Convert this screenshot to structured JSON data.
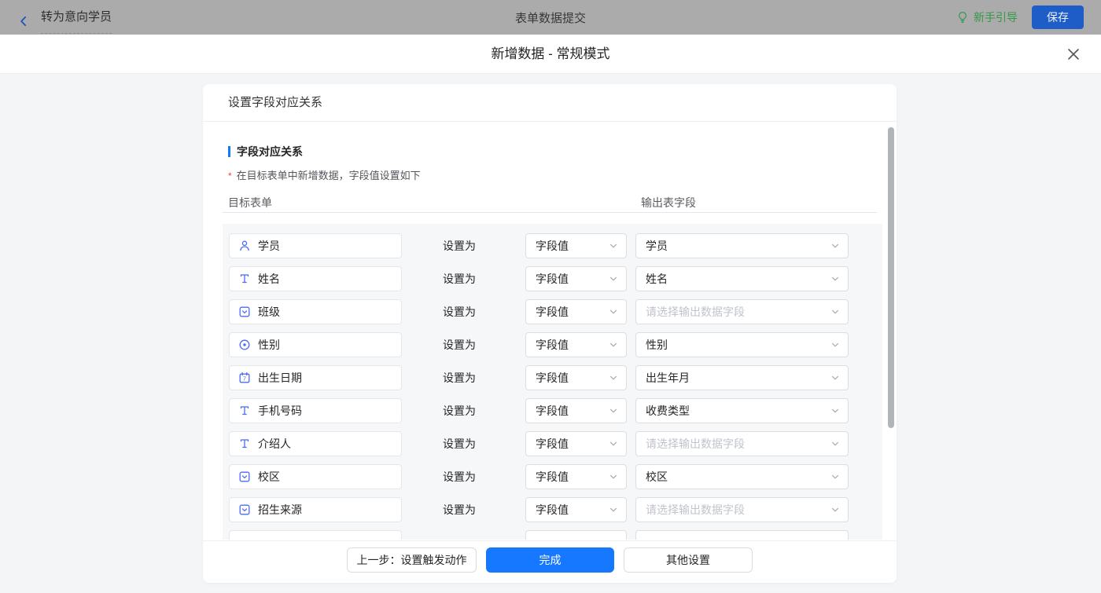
{
  "topbar": {
    "back_label": "转为意向学员",
    "title": "表单数据提交",
    "guide_label": "新手引导",
    "save_label": "保存"
  },
  "modal": {
    "title": "新增数据 - 常规模式"
  },
  "panel": {
    "header": "设置字段对应关系",
    "section_title": "字段对应关系",
    "note_mark": "*",
    "note": "在目标表单中新增数据，字段值设置如下",
    "col_left": "目标表单",
    "col_right": "输出表字段",
    "set_as_label": "设置为",
    "rows": [
      {
        "icon": "user-icon",
        "field": "学员",
        "mode": "字段值",
        "output": "学员",
        "placeholder": false
      },
      {
        "icon": "text-icon",
        "field": "姓名",
        "mode": "字段值",
        "output": "姓名",
        "placeholder": false
      },
      {
        "icon": "select-icon",
        "field": "班级",
        "mode": "字段值",
        "output": "请选择输出数据字段",
        "placeholder": true
      },
      {
        "icon": "radio-icon",
        "field": "性别",
        "mode": "字段值",
        "output": "性别",
        "placeholder": false
      },
      {
        "icon": "date-icon",
        "field": "出生日期",
        "mode": "字段值",
        "output": "出生年月",
        "placeholder": false
      },
      {
        "icon": "text-icon",
        "field": "手机号码",
        "mode": "字段值",
        "output": "收费类型",
        "placeholder": false
      },
      {
        "icon": "text-icon",
        "field": "介绍人",
        "mode": "字段值",
        "output": "请选择输出数据字段",
        "placeholder": true
      },
      {
        "icon": "select-icon",
        "field": "校区",
        "mode": "字段值",
        "output": "校区",
        "placeholder": false
      },
      {
        "icon": "select-icon",
        "field": "招生来源",
        "mode": "字段值",
        "output": "请选择输出数据字段",
        "placeholder": true
      },
      {
        "icon": null,
        "field": "",
        "mode": "",
        "output": "",
        "placeholder": false,
        "partial": true
      }
    ]
  },
  "footer": {
    "prev_label": "上一步：设置触发动作",
    "finish_label": "完成",
    "other_label": "其他设置"
  },
  "colors": {
    "accent_blue": "#1677ff",
    "dimmed_save_blue": "#1e5cc8",
    "guide_green": "#35984a",
    "field_icon_blue": "#4a6cf0",
    "required_red": "#f53f3f",
    "topbar_dim_gray": "#ababab"
  }
}
